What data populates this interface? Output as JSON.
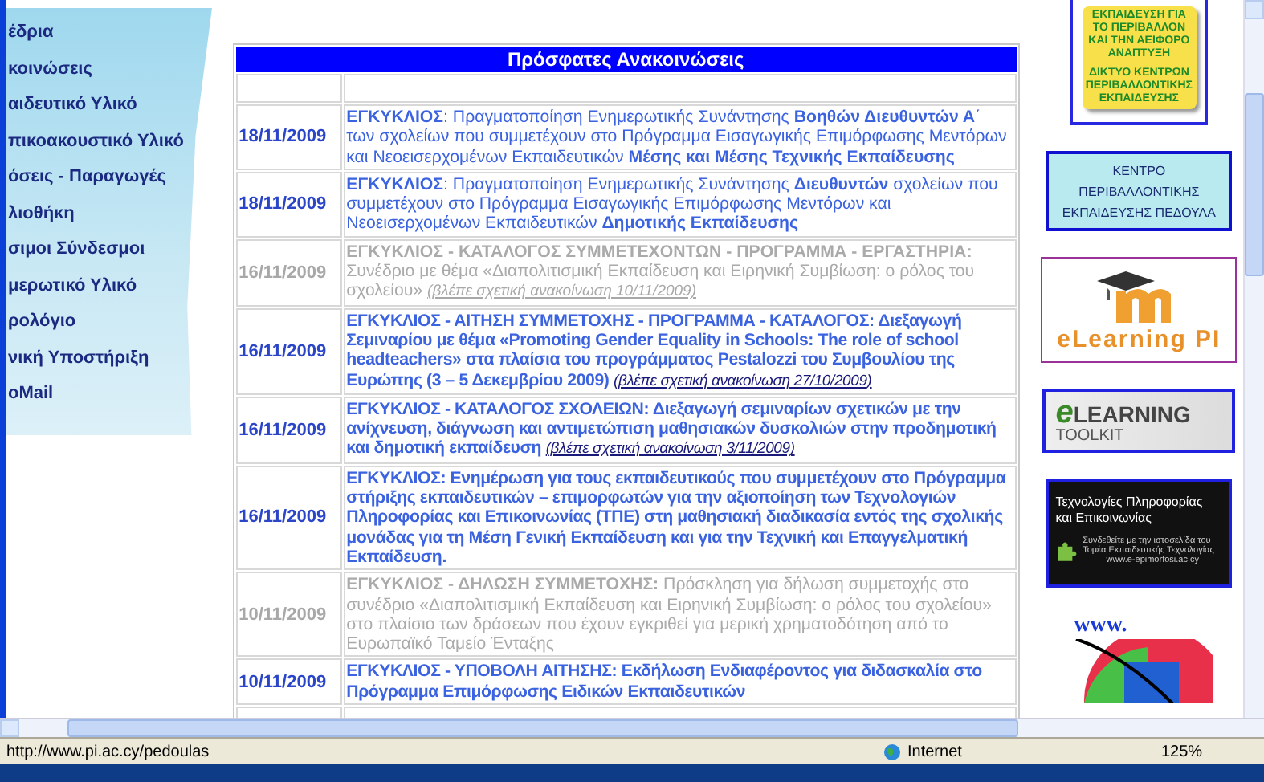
{
  "sidebar": {
    "items": [
      {
        "label": "έδρια"
      },
      {
        "label": "κοινώσεις"
      },
      {
        "label": "αιδευτικό Υλικό"
      },
      {
        "label": "πικοακουστικό Υλικό"
      },
      {
        "label": "όσεις - Παραγωγές"
      },
      {
        "label": "λιοθήκη"
      },
      {
        "label": "σιμοι Σύνδεσμοι"
      },
      {
        "label": "μερωτικό Υλικό"
      },
      {
        "label": "ρολόγιο"
      },
      {
        "label": "νική Υποστήριξη"
      },
      {
        "label": "oMail"
      }
    ]
  },
  "announcements": {
    "title": "Πρόσφατες Ανακοινώσεις",
    "rows": [
      {
        "date": "18/11/2009",
        "text": "**ΕΓΚΥΚΛΙΟΣ**: Πραγματοποίηση Ενημερωτικής Συνάντησης **Βοηθών Διευθυντών Α΄** των σχολείων που συμμετέχουν στο Πρόγραμμα Εισαγωγικής Επιμόρφωσης Μεντόρων και Νεοεισερχομένων Εκπαιδευτικών **Μέσης και Μέσης Τεχνικής Εκπαίδευσης**",
        "bold": false,
        "archived": false
      },
      {
        "date": "18/11/2009",
        "text": "**ΕΓΚΥΚΛΙΟΣ**: Πραγματοποίηση Ενημερωτικής Συνάντησης **Διευθυντών** σχολείων που συμμετέχουν στο Πρόγραμμα Εισαγωγικής Επιμόρφωσης Μεντόρων και Νεοεισερχομένων Εκπαιδευτικών **Δημοτικής Εκπαίδευσης**",
        "bold": false,
        "archived": false
      },
      {
        "date": "16/11/2009",
        "text": "**ΕΓΚΥΚΛΙΟΣ - ΚΑΤΑΛΟΓΟΣ ΣΥΜΜΕΤΕΧΟΝΤΩΝ - ΠΡΟΓΡΑΜΜΑ - ΕΡΓΑΣΤΗΡΙΑ:** Συνέδριο με θέμα «Διαπολιτισμική Εκπαίδευση και Ειρηνική Συμβίωση: ο ρόλος του σχολείου»",
        "link": "(βλέπε σχετική ανακοίνωση 10/11/2009)",
        "bold": false,
        "archived": true
      },
      {
        "date": "16/11/2009",
        "text": "**ΕΓΚΥΚΛΙΟΣ - ΑΙΤΗΣΗ ΣΥΜΜΕΤΟΧΗΣ - ΠΡΟΓΡΑΜΜΑ - ΚΑΤΑΛΟΓΟΣ:** Διεξαγωγή Σεμιναρίου με θέμα «Promoting Gender Equality in Schools: The role of school headteachers» στα πλαίσια του προγράμματος Pestalozzi του Συμβουλίου της Ευρώπης (3 – 5 Δεκεμβρίου 2009)",
        "link": "(βλέπε σχετική ανακοίνωση 27/10/2009)",
        "bold": true,
        "archived": false
      },
      {
        "date": "16/11/2009",
        "text": "**ΕΓΚΥΚΛΙΟΣ - ΚΑΤΑΛΟΓΟΣ ΣΧΟΛΕΙΩΝ:** Διεξαγωγή σεμιναρίων σχετικών με την ανίχνευση, διάγνωση και αντιμετώπιση μαθησιακών δυσκολιών στην προδημοτική και δημοτική εκπαίδευση",
        "link": "(βλέπε σχετική ανακοίνωση 3/11/2009)",
        "bold": true,
        "archived": false
      },
      {
        "date": "16/11/2009",
        "text": "**ΕΓΚΥΚΛΙΟΣ:** Ενημέρωση για τους εκπαιδευτικούς που συμμετέχουν στο Πρόγραμμα στήριξης εκπαιδευτικών – επιμορφωτών για την αξιοποίηση των Τεχνολογιών Πληροφορίας και Επικοινωνίας (ΤΠΕ) στη μαθησιακή διαδικασία εντός της σχολικής μονάδας για τη Μέση Γενική Εκπαίδευση και για την Τεχνική και Επαγγελματική Εκπαίδευση.",
        "bold": true,
        "archived": false
      },
      {
        "date": "10/11/2009",
        "text": "**ΕΓΚΥΚΛΙΟΣ - ΔΗΛΩΣΗ ΣΥΜΜΕΤΟΧΗΣ:** Πρόσκληση για δήλωση συμμετοχής στο συνέδριο «Διαπολιτισμική Εκπαίδευση και Ειρηνική Συμβίωση: ο ρόλος του σχολείου» στο πλαίσιο των δράσεων που έχουν εγκριθεί για μερική χρηματοδότηση από το Ευρωπαϊκό Ταμείο Ένταξης",
        "bold": false,
        "archived": true
      },
      {
        "date": "10/11/2009",
        "text": "**ΕΓΚΥΚΛΙΟΣ - ΥΠΟΒΟΛΗ ΑΙΤΗΣΗΣ:** Εκδήλωση Ενδιαφέροντος για διδασκαλία στο Πρόγραμμα Επιμόρφωσης Ειδικών Εκπαιδευτικών",
        "bold": true,
        "archived": false
      }
    ]
  },
  "banners": [
    {
      "kind": "environment",
      "lines": [
        "ΕΚΠΑΙΔΕΥΣΗ ΓΙΑ ΤΟ ΠΕΡΙΒΑΛΛΟΝ ΚΑΙ ΤΗΝ ΑΕΙΦΟΡΟ ΑΝΑΠΤΥΞΗ",
        "ΔΙΚΤΥΟ ΚΕΝΤΡΩΝ ΠΕΡΙΒΑΛΛΟΝΤΙΚΗΣ ΕΚΠΑΙΔΕΥΣΗΣ"
      ]
    },
    {
      "kind": "centre",
      "lines": [
        "ΚΕΝΤΡΟ ΠΕΡΙΒΑΛΛΟΝΤΙΚΗΣ ΕΚΠΑΙΔΕΥΣΗΣ ΠΕΔΟΥΛΑ"
      ]
    },
    {
      "kind": "moodle",
      "lines": [
        "eLearning PI"
      ]
    },
    {
      "kind": "toolkit",
      "lines": [
        "e",
        "LEARNING",
        "TOOLKIT"
      ]
    },
    {
      "kind": "ict",
      "lines": [
        "Τεχνολογίες Πληροφορίας και Επικοινωνίας",
        "Συνδεθείτε με την ιστοσελίδα του Τομέα Εκπαιδευτικής Τεχνολογίας",
        "www.e-epimorfosi.ac.cy"
      ]
    },
    {
      "kind": "www",
      "lines": [
        "www."
      ]
    }
  ],
  "status_bar": {
    "url": "http://www.pi.ac.cy/pedoulas",
    "zone": "Internet",
    "zoom": "125%"
  }
}
